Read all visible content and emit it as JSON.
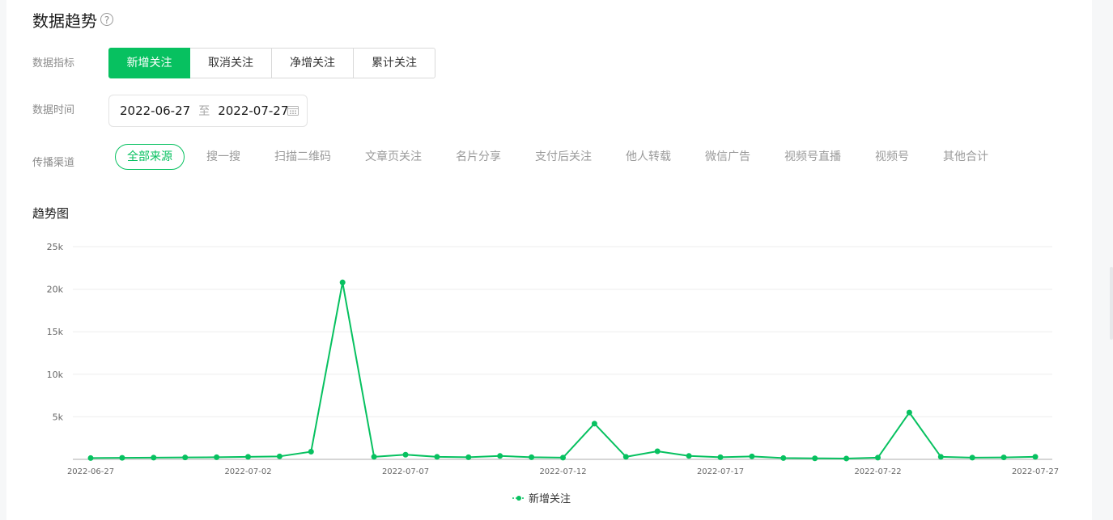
{
  "header": {
    "title": "数据趋势",
    "help_glyph": "?"
  },
  "filters": {
    "metric_label": "数据指标",
    "metrics": [
      {
        "label": "新增关注",
        "active": true
      },
      {
        "label": "取消关注",
        "active": false
      },
      {
        "label": "净增关注",
        "active": false
      },
      {
        "label": "累计关注",
        "active": false
      }
    ],
    "time_label": "数据时间",
    "date_start": "2022-06-27",
    "date_sep": "至",
    "date_end": "2022-07-27",
    "channel_label": "传播渠道",
    "channels": [
      {
        "label": "全部来源",
        "active": true
      },
      {
        "label": "搜一搜"
      },
      {
        "label": "扫描二维码"
      },
      {
        "label": "文章页关注"
      },
      {
        "label": "名片分享"
      },
      {
        "label": "支付后关注"
      },
      {
        "label": "他人转载"
      },
      {
        "label": "微信广告"
      },
      {
        "label": "视频号直播"
      },
      {
        "label": "视频号"
      },
      {
        "label": "其他合计"
      }
    ]
  },
  "chart_section": {
    "title": "趋势图"
  },
  "colors": {
    "accent": "#07c160"
  },
  "chart_data": {
    "type": "line",
    "x": [
      "2022-06-27",
      "2022-06-28",
      "2022-06-29",
      "2022-06-30",
      "2022-07-01",
      "2022-07-02",
      "2022-07-03",
      "2022-07-04",
      "2022-07-05",
      "2022-07-06",
      "2022-07-07",
      "2022-07-08",
      "2022-07-09",
      "2022-07-10",
      "2022-07-11",
      "2022-07-12",
      "2022-07-13",
      "2022-07-14",
      "2022-07-15",
      "2022-07-16",
      "2022-07-17",
      "2022-07-18",
      "2022-07-19",
      "2022-07-20",
      "2022-07-21",
      "2022-07-22",
      "2022-07-23",
      "2022-07-24",
      "2022-07-25",
      "2022-07-26",
      "2022-07-27"
    ],
    "x_tick_labels": [
      "2022-06-27",
      "2022-07-02",
      "2022-07-07",
      "2022-07-12",
      "2022-07-17",
      "2022-07-22",
      "2022-07-27"
    ],
    "y_ticks": [
      "5k",
      "10k",
      "15k",
      "20k",
      "25k"
    ],
    "ylim": [
      0,
      25000
    ],
    "grid": true,
    "series": [
      {
        "name": "新增关注",
        "values": [
          150,
          180,
          200,
          220,
          250,
          300,
          350,
          900,
          20800,
          300,
          550,
          300,
          250,
          400,
          250,
          200,
          4200,
          300,
          950,
          400,
          250,
          350,
          150,
          120,
          100,
          200,
          5500,
          300,
          200,
          230,
          300
        ]
      }
    ],
    "legend_position": "bottom-center"
  }
}
